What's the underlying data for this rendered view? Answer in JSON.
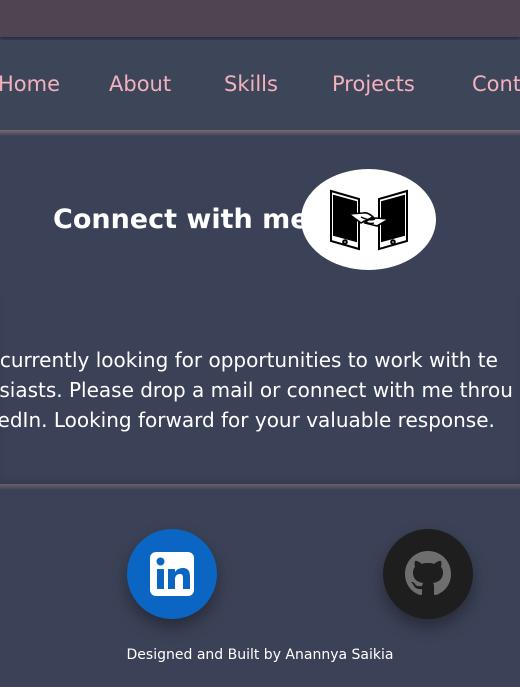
{
  "nav": {
    "items": [
      {
        "label": "Home"
      },
      {
        "label": "About"
      },
      {
        "label": "Skills"
      },
      {
        "label": "Projects"
      },
      {
        "label": "Conta"
      }
    ]
  },
  "hero": {
    "title": "Connect with me",
    "logo_icon": "handshake-phones-icon"
  },
  "message": {
    "lines": [
      "m currently looking for opportunities to work with te",
      "husiasts. Please drop a mail or connect with me throu",
      "nkedIn. Looking forward for your valuable response."
    ]
  },
  "social": {
    "linkedin_icon": "linkedin-icon",
    "github_icon": "github-icon"
  },
  "footer": {
    "credit": "Designed and Built by Anannya Saikia"
  },
  "colors": {
    "background": "#3b4257",
    "nav_text": "#f3b1bd",
    "topbar": "#4f4552",
    "linkedin": "#0a66c2",
    "github": "#1e1e1e"
  }
}
